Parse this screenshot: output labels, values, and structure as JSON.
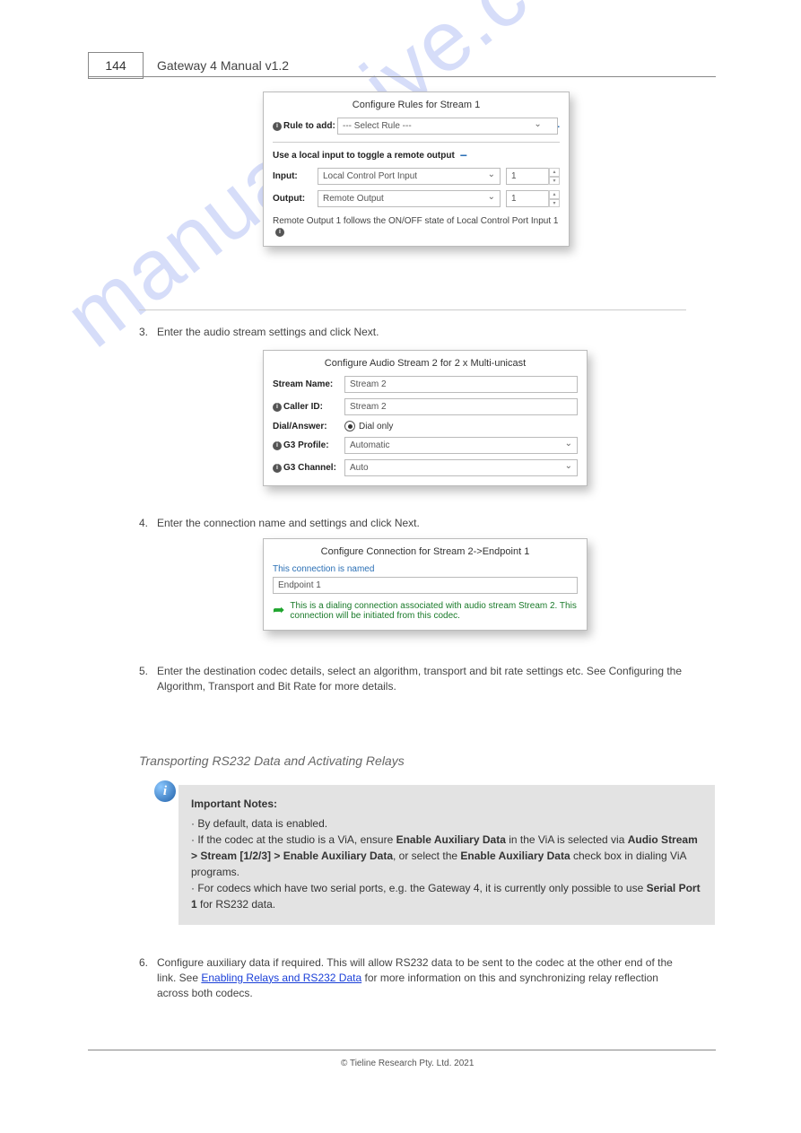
{
  "header": {
    "page_number": "144",
    "title": "Gateway 4 Manual v1.2"
  },
  "panel_rules": {
    "title": "Configure Rules for Stream 1",
    "rule_to_add_label": "Rule to add:",
    "rule_to_add_value": "--- Select Rule ---",
    "subrule_title": "Use a local input to toggle a remote output",
    "input_label": "Input:",
    "input_select": "Local Control Port Input",
    "input_number": "1",
    "output_label": "Output:",
    "output_select": "Remote Output",
    "output_number": "1",
    "rule_description": "Remote Output 1 follows the ON/OFF state of Local Control Port Input 1"
  },
  "step3_num": "3.",
  "step3": "Enter the audio stream settings and click Next.",
  "panel_stream": {
    "title": "Configure Audio Stream 2 for 2 x Multi-unicast",
    "stream_name_label": "Stream Name:",
    "stream_name_value": "Stream 2",
    "caller_id_label": "Caller ID:",
    "caller_id_value": "Stream 2",
    "dial_answer_label": "Dial/Answer:",
    "dial_answer_value": "Dial only",
    "g3_profile_label": "G3 Profile:",
    "g3_profile_value": "Automatic",
    "g3_channel_label": "G3 Channel:",
    "g3_channel_value": "Auto"
  },
  "step4_num": "4.",
  "step4": "Enter the connection name and settings and click Next.",
  "panel_conn": {
    "title": "Configure Connection for Stream 2->Endpoint 1",
    "named_label": "This connection is named",
    "named_value": "Endpoint 1",
    "desc": "This is a dialing connection associated with audio stream Stream 2. This connection will be initiated from this codec."
  },
  "step5_num": "5.",
  "step5": "Enter the destination codec details, select an algorithm, transport and bit rate settings etc. See Configuring the Algorithm, Transport and Bit Rate for more details.",
  "subheading": "Transporting RS232 Data and Activating Relays",
  "infobox": {
    "title": "Important Notes:",
    "line1": "By default, data is enabled.",
    "line2_a": "If the codec at the studio is a ViA, ensure ",
    "line2_b": "Enable Auxiliary Data",
    "line2_c": " in the ViA is selected via ",
    "line2_d": "Audio Stream > Stream [1/2/3] > Enable Auxiliary Data",
    "line2_e": ", or select the ",
    "line2_f": "Enable Auxiliary Data",
    "line2_g": " check box in dialing ViA programs.",
    "line3_a": "For codecs which have two serial ports, e.g. the Gateway 4, it is currently only possible to use ",
    "line3_b": "Serial Port 1",
    "line3_c": " for RS232 data."
  },
  "step6_num": "6.",
  "step6_a": "Configure auxiliary data if required. This will allow RS232 data to be sent to the codec at the other end of the link. See ",
  "step6_link": "Enabling Relays and RS232 Data",
  "step6_b": " for more information on this and synchronizing relay reflection across both codecs.",
  "footer": {
    "copyright": "© Tieline Research Pty. Ltd. 2021"
  }
}
